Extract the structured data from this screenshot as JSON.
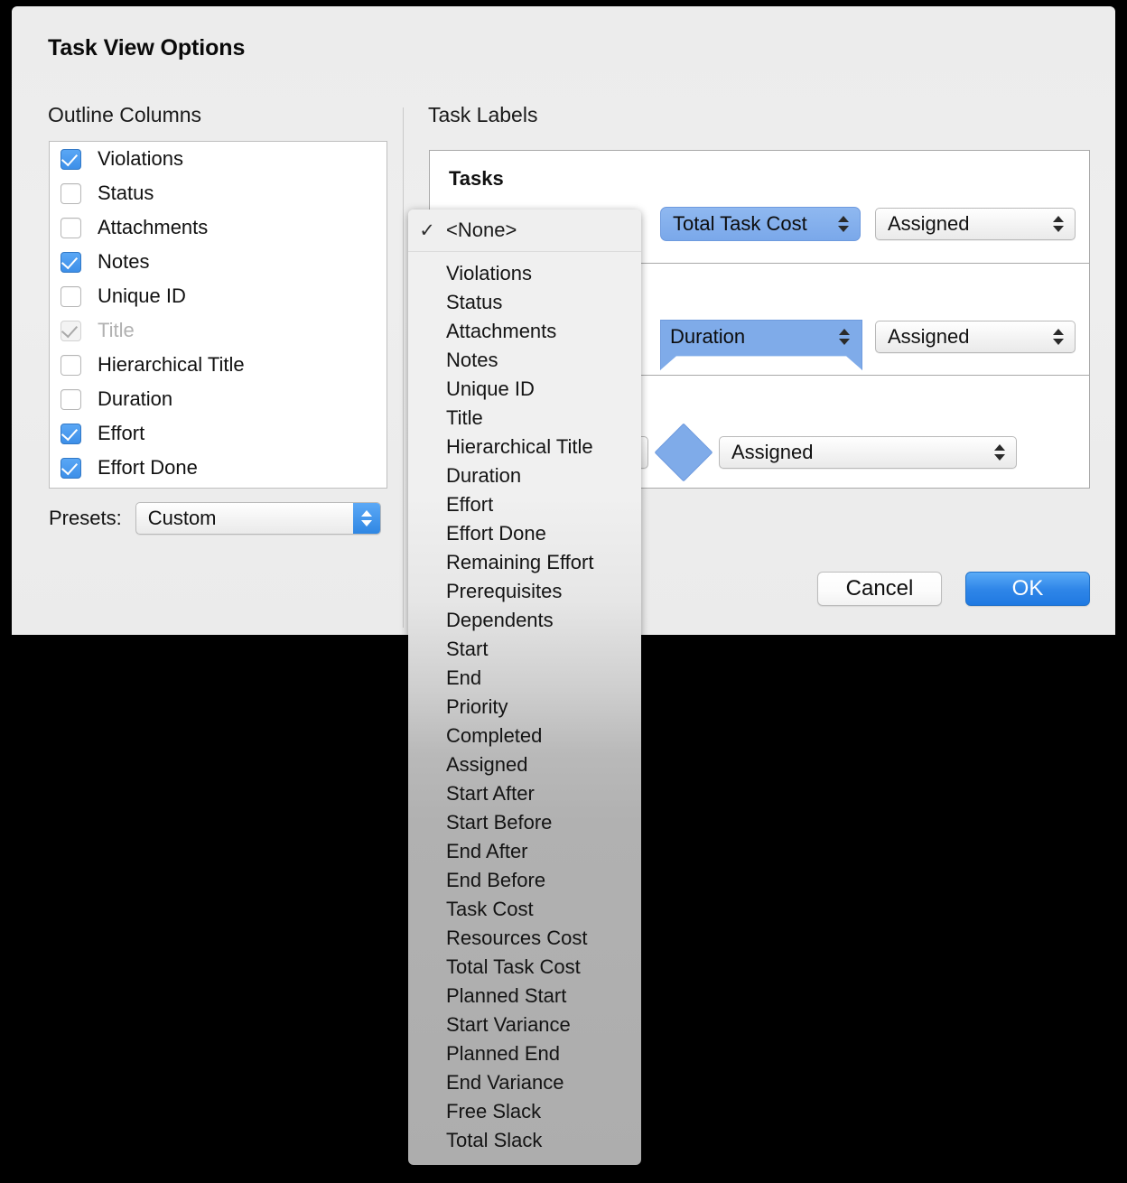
{
  "dialog": {
    "title": "Task View Options",
    "sections": {
      "outline_columns": "Outline Columns",
      "task_labels": "Task Labels"
    },
    "buttons": {
      "cancel": "Cancel",
      "ok": "OK"
    }
  },
  "outline_columns": {
    "items": [
      {
        "label": "Violations",
        "checked": true,
        "disabled": false
      },
      {
        "label": "Status",
        "checked": false,
        "disabled": false
      },
      {
        "label": "Attachments",
        "checked": false,
        "disabled": false
      },
      {
        "label": "Notes",
        "checked": true,
        "disabled": false
      },
      {
        "label": "Unique ID",
        "checked": false,
        "disabled": false
      },
      {
        "label": "Title",
        "checked": true,
        "disabled": true
      },
      {
        "label": "Hierarchical Title",
        "checked": false,
        "disabled": false
      },
      {
        "label": "Duration",
        "checked": false,
        "disabled": false
      },
      {
        "label": "Effort",
        "checked": true,
        "disabled": false
      },
      {
        "label": "Effort Done",
        "checked": true,
        "disabled": false
      }
    ],
    "presets_label": "Presets:",
    "presets_value": "Custom"
  },
  "task_labels": {
    "rows": [
      {
        "title": "Tasks",
        "shape": "task-bar",
        "left_value": "Total Task Cost",
        "right_value": "Assigned"
      },
      {
        "title": "",
        "shape": "summary-bar",
        "left_value": "Duration",
        "right_value": "Assigned"
      },
      {
        "title": "",
        "shape": "milestone-diamond",
        "left_value": "",
        "right_value": "Assigned"
      }
    ]
  },
  "dropdown_menu": {
    "checkmark": "✓",
    "selected": "<None>",
    "items": [
      "Violations",
      "Status",
      "Attachments",
      "Notes",
      "Unique ID",
      "Title",
      "Hierarchical Title",
      "Duration",
      "Effort",
      "Effort Done",
      "Remaining Effort",
      "Prerequisites",
      "Dependents",
      "Start",
      "End",
      "Priority",
      "Completed",
      "Assigned",
      "Start After",
      "Start Before",
      "End After",
      "End Before",
      "Task Cost",
      "Resources Cost",
      "Total Task Cost",
      "Planned Start",
      "Start Variance",
      "Planned End",
      "End Variance",
      "Free Slack",
      "Total Slack"
    ]
  },
  "colors": {
    "accent_blue": "#3d8fe8",
    "gantt_blue": "#7fabe9",
    "ok_button_blue": "#2f86e8"
  }
}
